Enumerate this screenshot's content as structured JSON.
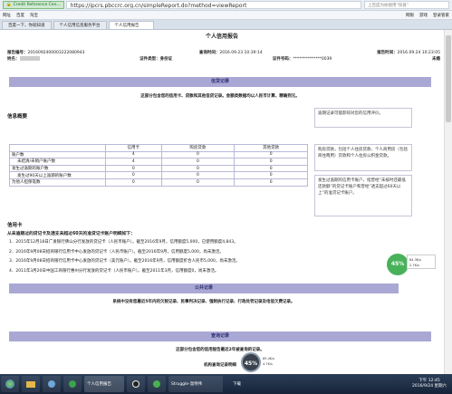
{
  "browser": {
    "cert_label": "Credit Reference Cen...",
    "url": "https://ipcrs.pbccrc.org.cn/simpleReport.do?method=viewReport",
    "search_placeholder": "上百度为依搜用“快艮”",
    "favs": [
      "网址",
      "百度",
      "淘宝"
    ],
    "favs_right": [
      "网银",
      "游戏",
      "登录管家"
    ],
    "tabs": [
      "百度一下，你就知道",
      "个人信用信息服务平台",
      "个人信用报告"
    ]
  },
  "report": {
    "title": "个人信用报告",
    "report_no_label": "报告编号：",
    "report_no": "2016092400003222080943",
    "query_time_label": "查询时间：",
    "query_time": "2016.09.23 10:39:14",
    "report_time_label": "报告时间：",
    "report_time": "2016.09.24 10:23:05",
    "name_label": "姓名：",
    "id_type_label": "证件类型：身份证",
    "id_no_label": "证件号码：",
    "id_no": "**************0039",
    "marital": "未婚"
  },
  "credit": {
    "bar": "信贷记录",
    "note": "这部分包含您的信用卡、贷款和其他信贷记录。金额类数据均以人民币计算，精确到元。",
    "overview_title": "信息概要",
    "side_note1": "逾期记录可能影响对您的信用评价。",
    "columns": [
      "信用卡",
      "购房贷款",
      "其他贷款"
    ],
    "rows": [
      {
        "label": "账户数",
        "values": [
          "4",
          "0",
          "0"
        ]
      },
      {
        "label": "未结清/未销户账户数",
        "values": [
          "4",
          "0",
          "0"
        ]
      },
      {
        "label": "发生过逾期的账户数",
        "values": [
          "0",
          "0",
          "0"
        ]
      },
      {
        "label": "发生过90天以上逾期的账户数",
        "values": [
          "0",
          "0",
          "0"
        ]
      },
      {
        "label": "为他人担保笔数",
        "values": [
          "0",
          "0",
          "0"
        ]
      }
    ],
    "side_note2": "购房贷款，包括个人住房贷款、个人商用房（包括商住两用）贷款和个人住房公积金贷款。",
    "side_note3": "发生过逾期的信用卡账户，指曾经“未按时还最低还款额”的贷记卡账户和曾经“透支超过60天以上”的准贷记卡账户。",
    "cc_heading": "信用卡",
    "cc_sub": "从未逾期过的贷记卡及透支未超过60天的准贷记卡账户明细如下：",
    "cc_items": [
      "1．2015年12月18日广发银行佛山分行发放的贷记卡（人民币账户）。截至2016年9月，信用额度5,000，已使用额度4,843。",
      "2．2016年9月08日招商银行信用卡中心发放的贷记卡（人民币账户）。截至2016年9月，信用额度5,000，尚未激活。",
      "3．2016年9月08日招商银行信用卡中心发放的贷记卡（美元账户）。截至2016年9月，信用额度折合人民币5,000，尚未激活。",
      "4．2011年3月20日中国工商银行惠州分行发放的贷记卡（人民币账户）。截至2011年3月，信用额度0，尚未激活。"
    ]
  },
  "public": {
    "bar": "公共记录",
    "note": "系统中没有您最近5年内的欠税记录、民事判决记录、强制执行记录、行政处罚记录及电信欠费记录。"
  },
  "query": {
    "bar": "查询记录",
    "note": "这部分包含您的信用报告最近2年被查询的记录。",
    "sub": "机构查询记录明细"
  },
  "widgets": {
    "badge_value": "45%",
    "badge2_value": "45%",
    "net_up": "84.3K/s",
    "net_down": "2.7K/s",
    "net_up2": "85.4K/s",
    "net_down2": "4.7K/s"
  },
  "taskbar": {
    "tasks": [
      "个人信用报告",
      "Struggle-温侍伟"
    ],
    "tray_text": "下载",
    "time": "下午 12:45",
    "date": "2016/9/24 星期六"
  }
}
